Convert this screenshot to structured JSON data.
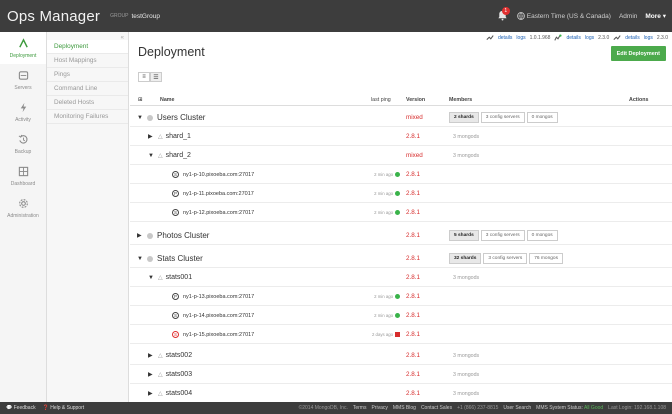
{
  "topbar": {
    "app_name": "Ops Manager",
    "group_label": "GROUP",
    "group_name": "testGroup",
    "notification_count": "1",
    "timezone": "Eastern Time (US & Canada)",
    "admin": "Admin",
    "more": "More ▾"
  },
  "linkbar": {
    "a_details": "details",
    "a_logs": "logs",
    "a_version": "1.0.1.968",
    "b_details": "details",
    "b_logs": "logs",
    "b_version": "2.3.0",
    "c_details": "details",
    "c_logs": "logs",
    "c_version": "2.3.0"
  },
  "nav": {
    "items": [
      {
        "label": "Deployment",
        "icon": "leaf-icon"
      },
      {
        "label": "Servers",
        "icon": "server-icon"
      },
      {
        "label": "Activity",
        "icon": "activity-icon"
      },
      {
        "label": "Backup",
        "icon": "backup-icon"
      },
      {
        "label": "Dashboard",
        "icon": "dashboard-icon"
      },
      {
        "label": "Administration",
        "icon": "gear-icon"
      }
    ]
  },
  "subnav": {
    "collapse": "«",
    "items": [
      "Deployment",
      "Host Mappings",
      "Pings",
      "Command Line",
      "Deleted Hosts",
      "Monitoring Failures"
    ]
  },
  "main": {
    "title": "Deployment",
    "edit_button": "Edit Deployment",
    "headers": {
      "expand": "⊞",
      "name": "Name",
      "last_ping": "last ping",
      "version": "Version",
      "members": "Members",
      "actions": "Actions"
    }
  },
  "rows": [
    {
      "caret": "▼",
      "name": "Users Cluster",
      "version": "mixed",
      "pills": [
        "2 shards",
        "3 config servers",
        "0 mongos"
      ]
    },
    {
      "caret": "▶",
      "name": "shard_1",
      "version": "2.8.1",
      "members": "3 mongods"
    },
    {
      "caret": "▼",
      "name": "shard_2",
      "version": "mixed",
      "members": "3 mongods"
    },
    {
      "host": "ny1-p-10.pixoeba.com:27017",
      "hicon": "S",
      "ping": "2 min ago",
      "version": "2.8.1"
    },
    {
      "host": "ny1-p-11.pixoeba.com:27017",
      "hicon": "P",
      "ping": "2 min ago",
      "version": "2.8.1"
    },
    {
      "host": "ny1-p-12.pixoeba.com:27017",
      "hicon": "S",
      "ping": "2 min ago",
      "version": "2.8.1"
    },
    {
      "caret": "▶",
      "name": "Photos Cluster",
      "version": "2.8.1",
      "pills": [
        "5 shards",
        "3 config servers",
        "0 mongos"
      ]
    },
    {
      "caret": "▼",
      "name": "Stats Cluster",
      "version": "2.8.1",
      "pills": [
        "32 shards",
        "3 config servers",
        "76 mongos"
      ]
    },
    {
      "caret": "▼",
      "name": "stats001",
      "version": "2.8.1",
      "members": "3 mongods"
    },
    {
      "host": "ny1-p-13.pixoeba.com:27017",
      "hicon": "P",
      "ping": "2 min ago",
      "version": "2.8.1"
    },
    {
      "host": "ny1-p-14.pixoeba.com:27017",
      "hicon": "S",
      "ping": "2 min ago",
      "version": "2.8.1"
    },
    {
      "host": "ny1-p-15.pixoeba.com:27017",
      "hicon": "S",
      "ping": "2 days ago",
      "version": "2.8.1"
    },
    {
      "caret": "▶",
      "name": "stats002",
      "version": "2.8.1",
      "members": "3 mongods"
    },
    {
      "caret": "▶",
      "name": "stats003",
      "version": "2.8.1",
      "members": "3 mongods"
    },
    {
      "caret": "▶",
      "name": "stats004",
      "version": "2.8.1",
      "members": "3 mongods"
    }
  ],
  "footer": {
    "feedback": "Feedback",
    "help": "Help & Support",
    "copyright": "©2014 MongoDB, Inc.",
    "terms": "Terms",
    "privacy": "Privacy",
    "blog": "MMS Blog",
    "contact": "Contact Sales",
    "phone": "+1 (866) 237-8815",
    "user_search": "User Search",
    "status_label": "MMS System Status:",
    "status_value": "All Good",
    "last_login": "Last Login: 192.168.1.108"
  },
  "colors": {
    "accent": "#4caa4c",
    "error": "#d72d2d",
    "ok": "#3ab34a",
    "topbar": "#3d3d3d"
  }
}
